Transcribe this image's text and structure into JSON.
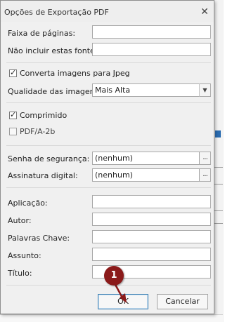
{
  "dialog": {
    "title": "Opções de Exportação PDF",
    "close_icon": "close-icon"
  },
  "fields": {
    "page_range": {
      "label": "Faixa de páginas:",
      "value": ""
    },
    "exclude_fonts": {
      "label": "Não incluir estas fontes:",
      "value": ""
    },
    "convert_jpeg": {
      "label": "Converta imagens para Jpeg",
      "checked": true
    },
    "image_quality": {
      "label": "Qualidade das imagens:",
      "value": "Mais Alta"
    },
    "compressed": {
      "label": "Comprimido",
      "checked": true
    },
    "pdfa": {
      "label": "PDF/A-2b",
      "checked": false
    },
    "security_password": {
      "label": "Senha de segurança:",
      "value": "(nenhum)",
      "button": "..."
    },
    "digital_signature": {
      "label": "Assinatura digital:",
      "value": "(nenhum)",
      "button": "..."
    },
    "application": {
      "label": "Aplicação:",
      "value": ""
    },
    "author": {
      "label": "Autor:",
      "value": ""
    },
    "keywords": {
      "label": "Palavras Chave:",
      "value": ""
    },
    "subject": {
      "label": "Assunto:",
      "value": ""
    },
    "title": {
      "label": "Título:",
      "value": ""
    }
  },
  "buttons": {
    "ok": "OK",
    "cancel": "Cancelar"
  },
  "annotation": {
    "step_number": "1",
    "color": "#8b1a1a"
  }
}
